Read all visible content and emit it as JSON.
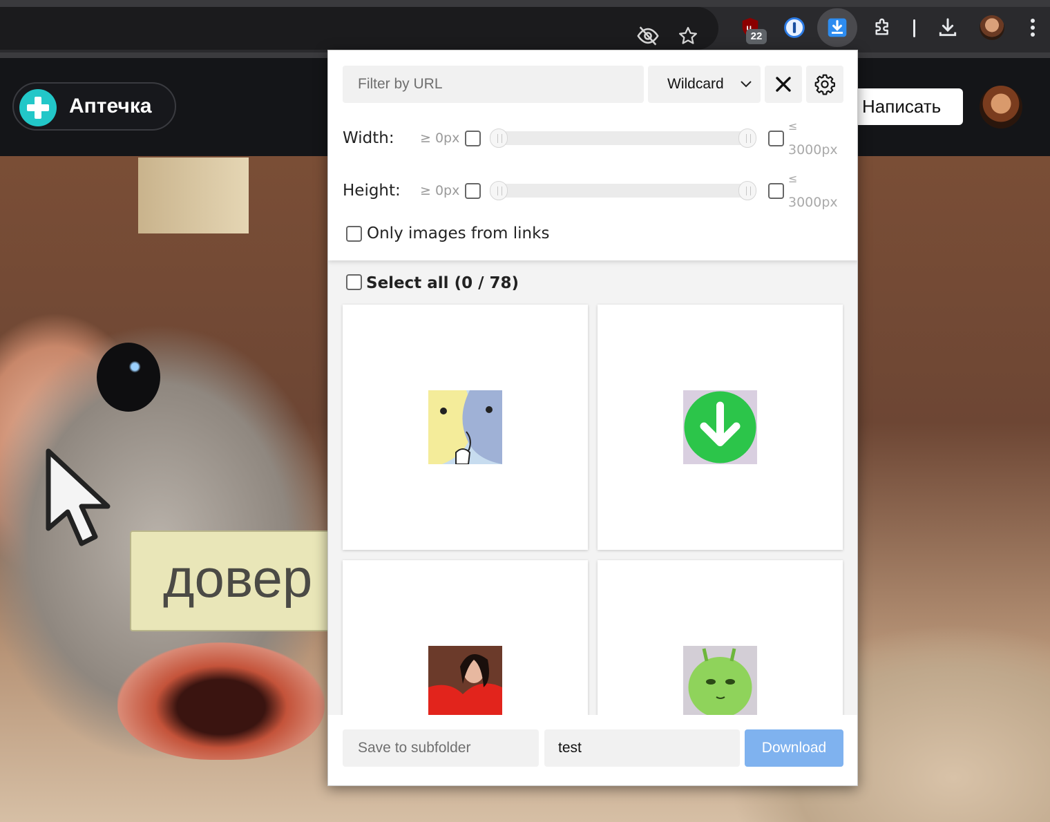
{
  "toolbar": {
    "ublock_badge": "22",
    "icons": [
      "eye-off-icon",
      "bookmark-star-icon",
      "ublock-icon",
      "onepassword-icon",
      "image-downloader-icon",
      "extensions-puzzle-icon",
      "downloads-icon",
      "profile-avatar",
      "kebab-menu-icon"
    ]
  },
  "site": {
    "logo_text": "Аптечка",
    "write_button": "Написать",
    "sign_text": "довер"
  },
  "popup": {
    "url_filter_placeholder": "Filter by URL",
    "filter_mode": "Wildcard",
    "width_label": "Width:",
    "height_label": "Height:",
    "min_prefix": "≥ 0px",
    "max_prefix": "≤",
    "max_value": "3000px",
    "only_links_label": "Only images from links",
    "select_all_label": "Select all (0 / 78)",
    "subfolder_placeholder": "Save to subfolder",
    "filename_value": "test",
    "download_label": "Download"
  },
  "images": [
    {
      "name": "cartoon-birds-thumbnail"
    },
    {
      "name": "green-download-arrow-thumbnail"
    },
    {
      "name": "woman-red-shirt-thumbnail"
    },
    {
      "name": "green-alien-cat-thumbnail"
    }
  ],
  "colors": {
    "accent": "#7fb2ef",
    "logo_accent": "#22c7c8",
    "active_ext": "#4a4a4e"
  }
}
